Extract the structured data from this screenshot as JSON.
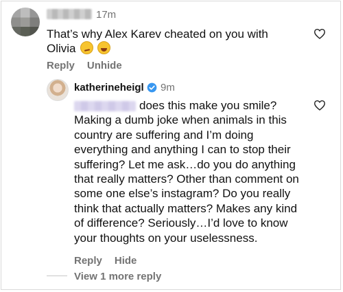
{
  "comment1": {
    "avatar_icon": "blurred-avatar",
    "time": "17m",
    "text": "That’s why Alex Karev cheated on you with Olivia",
    "emojis": [
      "smirking-face",
      "face-with-tears-of-joy"
    ],
    "actions": {
      "reply": "Reply",
      "unhide": "Unhide"
    },
    "like_icon": "heart-outline-icon"
  },
  "reply": {
    "username": "katherineheigl",
    "verified_icon": "verified-badge-icon",
    "time": "9m",
    "text": "does this make you smile? Making a dumb joke when animals in this country are suffering and I’m doing everything and anything I can to stop their suffering? Let me ask…do you do anything that really matters? Other than comment on some one else’s instagram? Do you really think that actually matters? Makes any kind of difference? Seriously…I’d love to know your thoughts on your uselessness.",
    "actions": {
      "reply": "Reply",
      "hide": "Hide"
    },
    "like_icon": "heart-outline-icon",
    "view_more": "View 1 more reply"
  },
  "colors": {
    "text": "#111111",
    "secondary": "#737373",
    "verified": "#3897f0"
  }
}
